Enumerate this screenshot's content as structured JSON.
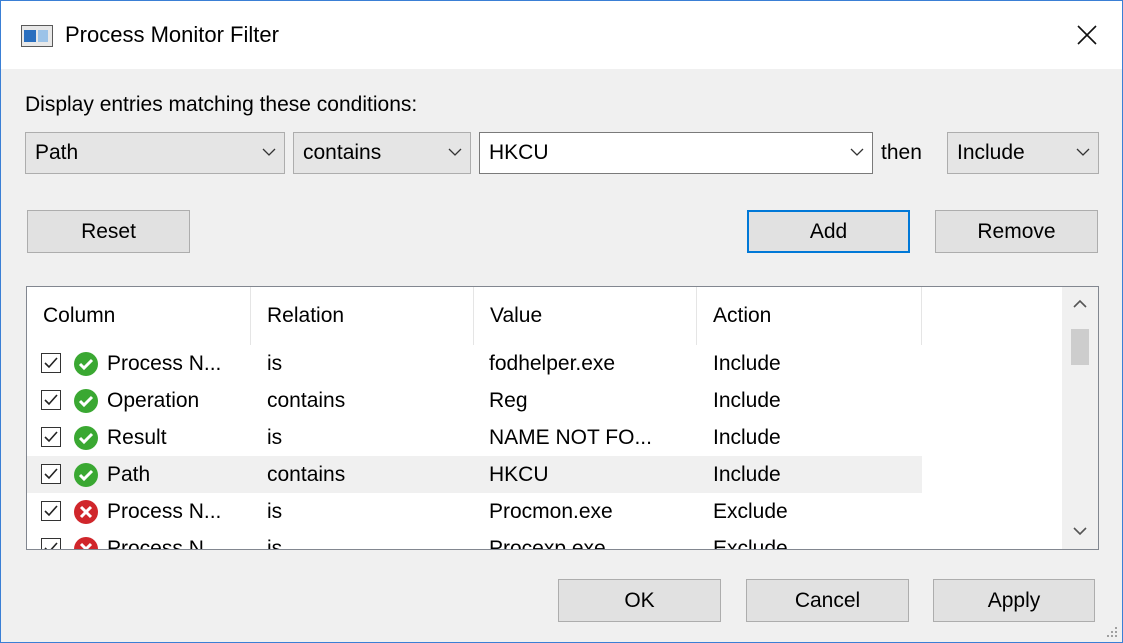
{
  "window": {
    "title": "Process Monitor Filter"
  },
  "filter": {
    "heading": "Display entries matching these conditions:",
    "column_select": "Path",
    "relation_select": "contains",
    "value_input": "HKCU",
    "then_label": "then",
    "action_select": "Include"
  },
  "buttons": {
    "reset": "Reset",
    "add": "Add",
    "remove": "Remove",
    "ok": "OK",
    "cancel": "Cancel",
    "apply": "Apply"
  },
  "list": {
    "columns": [
      "Column",
      "Relation",
      "Value",
      "Action"
    ],
    "rows": [
      {
        "checked": true,
        "icon": "green-check-icon",
        "column": "Process N...",
        "relation": "is",
        "value": "fodhelper.exe",
        "action": "Include"
      },
      {
        "checked": true,
        "icon": "green-check-icon",
        "column": "Operation",
        "relation": "contains",
        "value": "Reg",
        "action": "Include"
      },
      {
        "checked": true,
        "icon": "green-check-icon",
        "column": "Result",
        "relation": "is",
        "value": "NAME NOT FO...",
        "action": "Include"
      },
      {
        "checked": true,
        "icon": "green-check-icon",
        "column": "Path",
        "relation": "contains",
        "value": "HKCU",
        "action": "Include",
        "selected": true
      },
      {
        "checked": true,
        "icon": "red-x-icon",
        "column": "Process N...",
        "relation": "is",
        "value": "Procmon.exe",
        "action": "Exclude"
      },
      {
        "checked": true,
        "icon": "red-x-icon",
        "column": "Process N...",
        "relation": "is",
        "value": "Procexp.exe",
        "action": "Exclude"
      }
    ]
  },
  "colors": {
    "accent": "#0078d7",
    "include": "#3aa832",
    "exclude": "#d0262b",
    "selected_row": "#f0f0f0"
  }
}
